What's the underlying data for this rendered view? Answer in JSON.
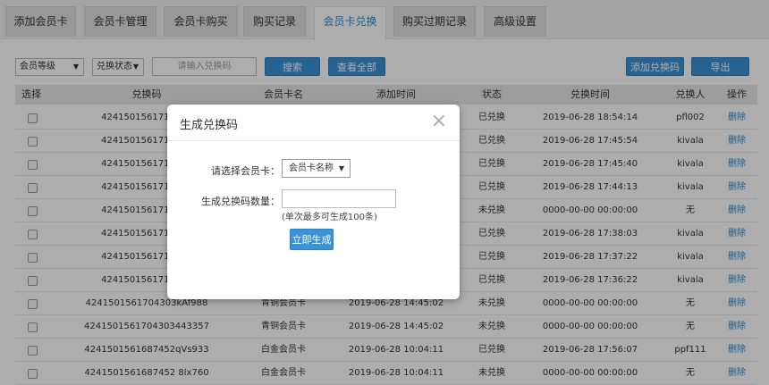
{
  "tabs": [
    {
      "label": "添加会员卡"
    },
    {
      "label": "会员卡管理"
    },
    {
      "label": "会员卡购买"
    },
    {
      "label": "购买记录"
    },
    {
      "label": "会员卡兑换"
    },
    {
      "label": "购买过期记录"
    },
    {
      "label": "高级设置"
    }
  ],
  "active_tab": "会员卡兑换",
  "toolbar": {
    "level_select": "会员等级",
    "status_select": "兑换状态",
    "code_placeholder": "请输入兑换码",
    "search_label": "搜索",
    "view_all_label": "查看全部",
    "add_code_label": "添加兑换码",
    "export_label": "导出"
  },
  "table": {
    "headers": [
      "选择",
      "兑换码",
      "会员卡名",
      "添加时间",
      "状态",
      "兑换时间",
      "兑换人",
      "操作"
    ],
    "rows": [
      {
        "code": "4241501561719002",
        "card": "",
        "added": "",
        "status": "已兑换",
        "redeemed": "2019-06-28 18:54:14",
        "user": "pfl002",
        "action": "删除"
      },
      {
        "code": "4241501561715092",
        "card": "",
        "added": "",
        "status": "已兑换",
        "redeemed": "2019-06-28 17:45:54",
        "user": "kivala",
        "action": "删除"
      },
      {
        "code": "4241501561715087",
        "card": "",
        "added": "",
        "status": "已兑换",
        "redeemed": "2019-06-28 17:45:40",
        "user": "kivala",
        "action": "删除"
      },
      {
        "code": "4241501561715037",
        "card": "",
        "added": "",
        "status": "已兑换",
        "redeemed": "2019-06-28 17:44:13",
        "user": "kivala",
        "action": "删除"
      },
      {
        "code": "4241501561714710",
        "card": "",
        "added": "",
        "status": "未兑换",
        "redeemed": "0000-00-00 00:00:00",
        "user": "无",
        "action": "删除"
      },
      {
        "code": "4241501561714679",
        "card": "",
        "added": "",
        "status": "已兑换",
        "redeemed": "2019-06-28 17:38:03",
        "user": "kivala",
        "action": "删除"
      },
      {
        "code": "4241501561714632",
        "card": "",
        "added": "",
        "status": "已兑换",
        "redeemed": "2019-06-28 17:37:22",
        "user": "kivala",
        "action": "删除"
      },
      {
        "code": "4241501561714573",
        "card": "",
        "added": "",
        "status": "已兑换",
        "redeemed": "2019-06-28 17:36:22",
        "user": "kivala",
        "action": "删除"
      },
      {
        "code": "4241501561704303kAf988",
        "card": "青铜会员卡",
        "added": "2019-06-28 14:45:02",
        "status": "未兑换",
        "redeemed": "0000-00-00 00:00:00",
        "user": "无",
        "action": "删除"
      },
      {
        "code": "4241501561704303443357",
        "card": "青铜会员卡",
        "added": "2019-06-28 14:45:02",
        "status": "未兑换",
        "redeemed": "0000-00-00 00:00:00",
        "user": "无",
        "action": "删除"
      },
      {
        "code": "4241501561687452qVs933",
        "card": "白金会员卡",
        "added": "2019-06-28 10:04:11",
        "status": "已兑换",
        "redeemed": "2019-06-28 17:56:07",
        "user": "ppf111",
        "action": "删除"
      },
      {
        "code": "4241501561687452 8lx760",
        "card": "白金会员卡",
        "added": "2019-06-28 10:04:11",
        "status": "未兑换",
        "redeemed": "0000-00-00 00:00:00",
        "user": "无",
        "action": "删除"
      }
    ]
  },
  "modal": {
    "title": "生成兑换码",
    "close_glyph": "×",
    "card_label": "请选择会员卡：",
    "card_select": "会员卡名称",
    "count_label": "生成兑换码数量：",
    "count_value": "",
    "hint": "(单次最多可生成100条)",
    "submit_label": "立即生成"
  },
  "colors": {
    "accent": "#3a93d6",
    "overlay": "rgba(0,0,0,0.32)",
    "link": "#2a8ad4"
  }
}
